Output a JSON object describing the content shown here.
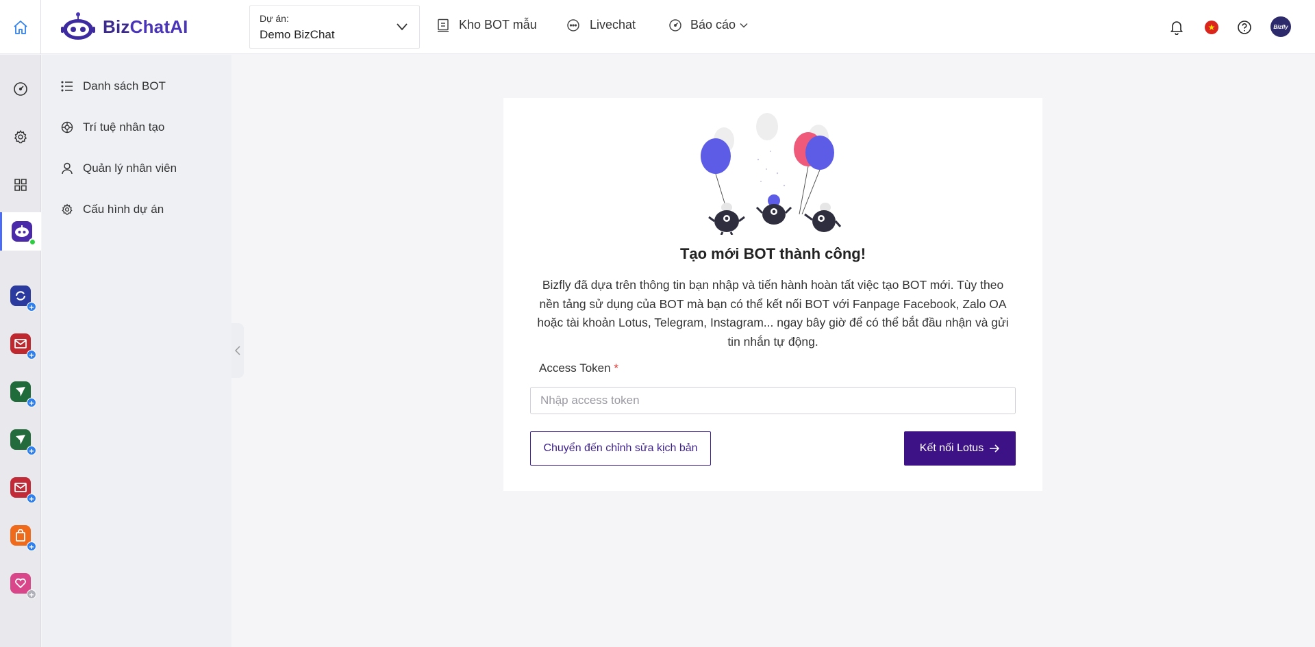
{
  "header": {
    "logo": {
      "part1": "Biz",
      "part2": "ChatAI"
    },
    "project": {
      "label": "Dự án:",
      "value": "Demo BizChat"
    },
    "nav": [
      {
        "label": "Kho BOT mẫu",
        "icon": "bot-template-icon"
      },
      {
        "label": "Livechat",
        "icon": "chat-bubble-icon"
      },
      {
        "label": "Báo cáo",
        "icon": "dashboard-icon"
      }
    ],
    "avatar_text": "Bizfly"
  },
  "sidebar": {
    "items": [
      {
        "label": "Danh sách BOT",
        "icon": "list-icon"
      },
      {
        "label": "Trí tuệ nhân tạo",
        "icon": "ai-icon"
      },
      {
        "label": "Quản lý nhân viên",
        "icon": "user-icon"
      },
      {
        "label": "Cấu hình dự án",
        "icon": "gear-icon"
      }
    ]
  },
  "card": {
    "title": "Tạo mới BOT thành công!",
    "description": "Bizfly đã dựa trên thông tin bạn nhập và tiến hành hoàn tất việc tạo BOT mới. Tùy theo nền tảng sử dụng của BOT mà bạn có thể kết nối BOT với Fanpage Facebook, Zalo OA hoặc tài khoản Lotus, Telegram, Instagram... ngay bây giờ để có thể bắt đầu nhận và gửi tin nhắn tự động.",
    "field_label": "Access Token",
    "required_mark": "*",
    "input_placeholder": "Nhập access token",
    "input_value": "",
    "secondary_button": "Chuyển đến chỉnh sửa kịch bản",
    "primary_button": "Kết nối Lotus"
  },
  "colors": {
    "primary": "#3d1286",
    "brand": "#4a35b8",
    "rail_accent": "#4a6cf7",
    "online": "#2ecc40",
    "badge_plus": "#2f80ed"
  }
}
